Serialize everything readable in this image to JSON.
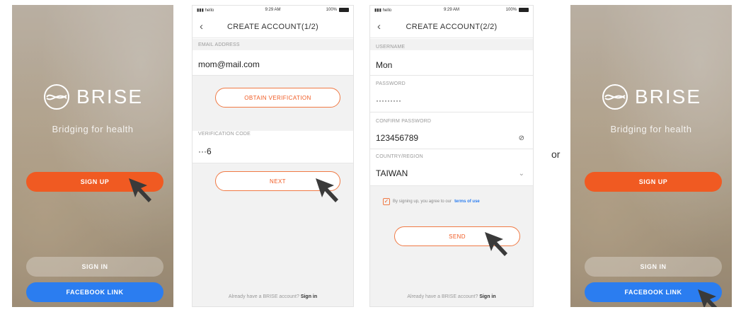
{
  "screen1": {
    "brand": "BRISE",
    "tagline": "Bridging for health",
    "signup_label": "SIGN UP",
    "signin_label": "SIGN IN",
    "facebook_label": "FACEBOOK LINK"
  },
  "screen2": {
    "status": {
      "carrier": "hello",
      "time": "9:29 AM",
      "battery": "100%"
    },
    "title": "CREATE ACCOUNT(1/2)",
    "email_label": "EMAIL ADDRESS",
    "email_value": "mom@mail.com",
    "obtain_label": "OBTAIN VERIFICATION",
    "code_label": "VERIFICATION CODE",
    "code_value": "···6",
    "next_label": "NEXT",
    "footer_text": "Already have a BRISE account?",
    "footer_link": "Sign in"
  },
  "screen3": {
    "status": {
      "carrier": "hello",
      "time": "9:29 AM",
      "battery": "100%"
    },
    "title": "CREATE ACCOUNT(2/2)",
    "username_label": "USERNAME",
    "username_value": "Mon",
    "password_label": "PASSWORD",
    "password_value": "·········",
    "confirm_label": "CONFIRM PASSWORD",
    "confirm_value": "123456789",
    "country_label": "COUNTRY/REGION",
    "country_value": "TAIWAN",
    "agree_text": "By signing up, you agree to our",
    "terms_label": "terms of use",
    "send_label": "SEND",
    "footer_text": "Already have a BRISE account?",
    "footer_link": "Sign in"
  },
  "separator": "or",
  "screen4": {
    "brand": "BRISE",
    "tagline": "Bridging for health",
    "signup_label": "SIGN UP",
    "signin_label": "SIGN IN",
    "facebook_label": "FACEBOOK LINK"
  },
  "colors": {
    "accent": "#f05a22",
    "facebook": "#2b7df0",
    "link": "#2b7df0"
  },
  "icons": [
    "brise-logo-icon",
    "back-chevron-icon",
    "eye-slash-icon",
    "chevron-down-icon",
    "checkbox-icon",
    "mouse-cursor-icon",
    "signal-icon",
    "wifi-icon",
    "battery-icon"
  ]
}
